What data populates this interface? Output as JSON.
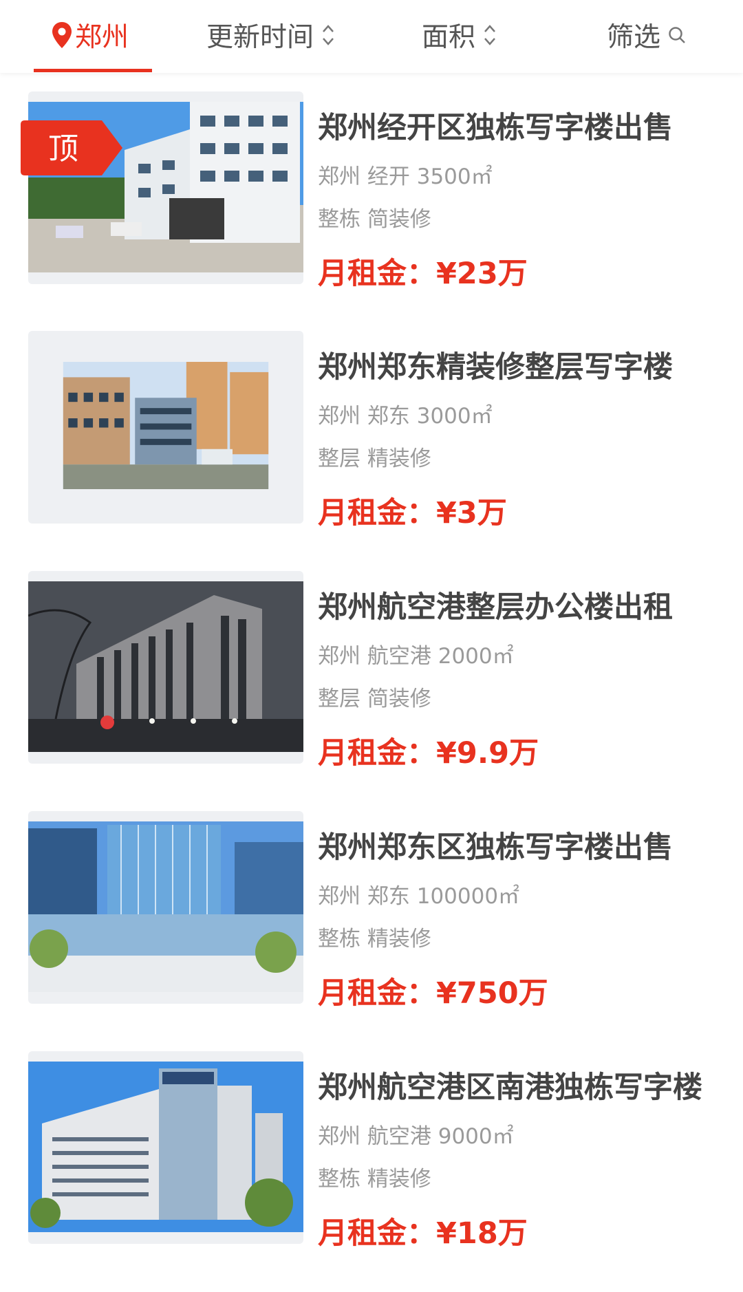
{
  "topbar": {
    "city": "郑州",
    "sort_update": "更新时间",
    "sort_area": "面积",
    "filter": "筛选"
  },
  "listings": [
    {
      "title": "郑州经开区独栋写字楼出售",
      "city": "郑州",
      "district": "经开",
      "area": "3500㎡",
      "type": "整栋",
      "decoration": "简装修",
      "price_label": "月租金：",
      "price": "¥23万",
      "badge": "顶"
    },
    {
      "title": "郑州郑东精装修整层写字楼",
      "city": "郑州",
      "district": "郑东",
      "area": "3000㎡",
      "type": "整层",
      "decoration": "精装修",
      "price_label": "月租金：",
      "price": "¥3万"
    },
    {
      "title": "郑州航空港整层办公楼出租",
      "city": "郑州",
      "district": "航空港",
      "area": "2000㎡",
      "type": "整层",
      "decoration": "简装修",
      "price_label": "月租金：",
      "price": "¥9.9万"
    },
    {
      "title": "郑州郑东区独栋写字楼出售",
      "city": "郑州",
      "district": "郑东",
      "area": "100000㎡",
      "type": "整栋",
      "decoration": "精装修",
      "price_label": "月租金：",
      "price": "¥750万"
    },
    {
      "title": "郑州航空港区南港独栋写字楼",
      "city": "郑州",
      "district": "航空港",
      "area": "9000㎡",
      "type": "整栋",
      "decoration": "精装修",
      "price_label": "月租金：",
      "price": "¥18万"
    }
  ],
  "colors": {
    "accent": "#e8321f",
    "title": "#444444",
    "meta": "#9a9a9a"
  }
}
